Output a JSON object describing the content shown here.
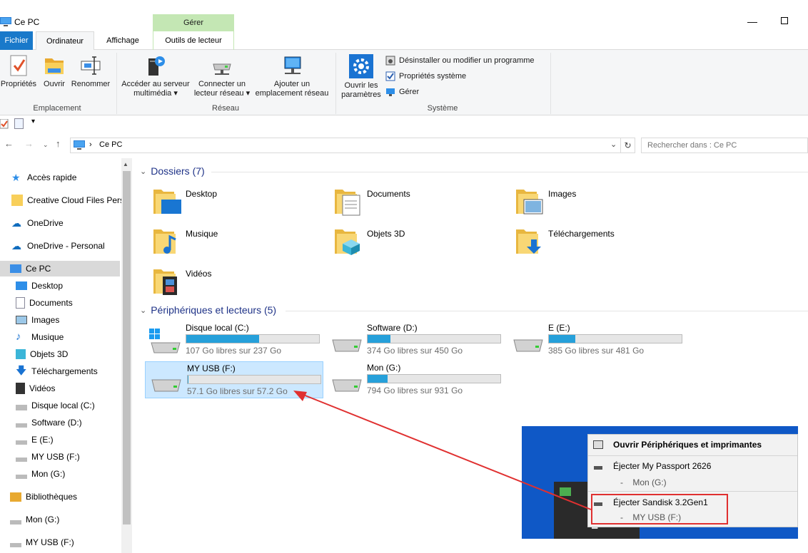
{
  "window": {
    "title": "Ce PC",
    "context_tab_group": "Gérer",
    "minimize_glyph": "—"
  },
  "tabs": {
    "fichier": "Fichier",
    "ordinateur": "Ordinateur",
    "affichage": "Affichage",
    "outils": "Outils de lecteur"
  },
  "ribbon": {
    "emplacement": {
      "label": "Emplacement",
      "proprietes": "Propriétés",
      "ouvrir": "Ouvrir",
      "renommer": "Renommer"
    },
    "reseau": {
      "label": "Réseau",
      "media_line1": "Accéder au serveur",
      "media_line2": "multimédia",
      "connect_line1": "Connecter un",
      "connect_line2": "lecteur réseau",
      "add_line1": "Ajouter un",
      "add_line2": "emplacement réseau"
    },
    "systeme": {
      "label": "Système",
      "params_line1": "Ouvrir les",
      "params_line2": "paramètres",
      "uninstall": "Désinstaller ou modifier un programme",
      "props": "Propriétés système",
      "manage": "Gérer"
    }
  },
  "address": {
    "path": "Ce PC",
    "search_placeholder": "Rechercher dans : Ce PC"
  },
  "nav": {
    "items": [
      {
        "label": "Accès rapide"
      },
      {
        "label": "Creative Cloud Files Personal"
      },
      {
        "label": "OneDrive"
      },
      {
        "label": "OneDrive - Personal"
      },
      {
        "label": "Ce PC"
      },
      {
        "label": "Desktop"
      },
      {
        "label": "Documents"
      },
      {
        "label": "Images"
      },
      {
        "label": "Musique"
      },
      {
        "label": "Objets 3D"
      },
      {
        "label": "Téléchargements"
      },
      {
        "label": "Vidéos"
      },
      {
        "label": "Disque local (C:)"
      },
      {
        "label": "Software (D:)"
      },
      {
        "label": "E (E:)"
      },
      {
        "label": "MY USB (F:)"
      },
      {
        "label": "Mon (G:)"
      },
      {
        "label": "Bibliothèques"
      },
      {
        "label": "Mon (G:)"
      },
      {
        "label": "MY USB (F:)"
      }
    ]
  },
  "content": {
    "folders_header": "Dossiers (7)",
    "devices_header": "Périphériques et lecteurs (5)",
    "folders": [
      {
        "name": "Desktop"
      },
      {
        "name": "Documents"
      },
      {
        "name": "Images"
      },
      {
        "name": "Musique"
      },
      {
        "name": "Objets 3D"
      },
      {
        "name": "Téléchargements"
      },
      {
        "name": "Vidéos"
      }
    ],
    "drives": [
      {
        "name": "Disque local (C:)",
        "free": "107 Go libres sur 237 Go",
        "used_fraction": 0.55
      },
      {
        "name": "Software (D:)",
        "free": "374 Go libres sur 450 Go",
        "used_fraction": 0.17
      },
      {
        "name": "E (E:)",
        "free": "385 Go libres sur 481 Go",
        "used_fraction": 0.2
      },
      {
        "name": "MY USB (F:)",
        "free": "57.1 Go libres sur 57.2 Go",
        "used_fraction": 0.002
      },
      {
        "name": "Mon (G:)",
        "free": "794 Go libres sur 931 Go",
        "used_fraction": 0.15
      }
    ]
  },
  "tray_menu": {
    "open_devices": "Ouvrir Périphériques et imprimantes",
    "eject1": "Éjecter My Passport 2626",
    "eject1_sub": "-    Mon (G:)",
    "eject2": "Éjecter Sandisk 3.2Gen1",
    "eject2_sub": "-    MY USB (F:)"
  },
  "colors": {
    "accent": "#1979ca",
    "drive_bar": "#26a0da",
    "section_header": "#1e3287",
    "annotation": "#e03030"
  }
}
